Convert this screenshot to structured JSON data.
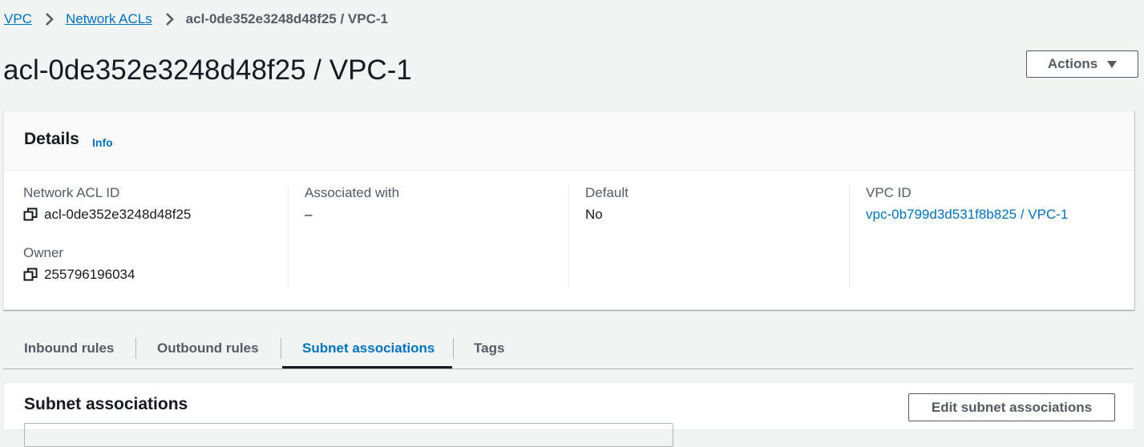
{
  "breadcrumb": {
    "items": [
      "VPC",
      "Network ACLs"
    ],
    "current": "acl-0de352e3248d48f25 / VPC-1"
  },
  "page": {
    "title": "acl-0de352e3248d48f25 / VPC-1",
    "actions_label": "Actions"
  },
  "details": {
    "title": "Details",
    "info_label": "Info",
    "network_acl_id_label": "Network ACL ID",
    "network_acl_id": "acl-0de352e3248d48f25",
    "owner_label": "Owner",
    "owner": "255796196034",
    "associated_with_label": "Associated with",
    "associated_with": "–",
    "default_label": "Default",
    "default_value": "No",
    "vpc_id_label": "VPC ID",
    "vpc_id": "vpc-0b799d3d531f8b825 / VPC-1"
  },
  "tabs": [
    {
      "label": "Inbound rules",
      "active": false
    },
    {
      "label": "Outbound rules",
      "active": false
    },
    {
      "label": "Subnet associations",
      "active": true
    },
    {
      "label": "Tags",
      "active": false
    }
  ],
  "subnet_associations": {
    "title": "Subnet associations",
    "edit_label": "Edit subnet associations"
  },
  "icons": {
    "copy": "copy-icon",
    "breadcrumb_separator": "chevron-right-icon",
    "actions_caret": "caret-down-icon"
  },
  "colors": {
    "link": "#0073bb",
    "background": "#f2f3f3",
    "text": "#16191f",
    "secondary_text": "#545b64"
  }
}
